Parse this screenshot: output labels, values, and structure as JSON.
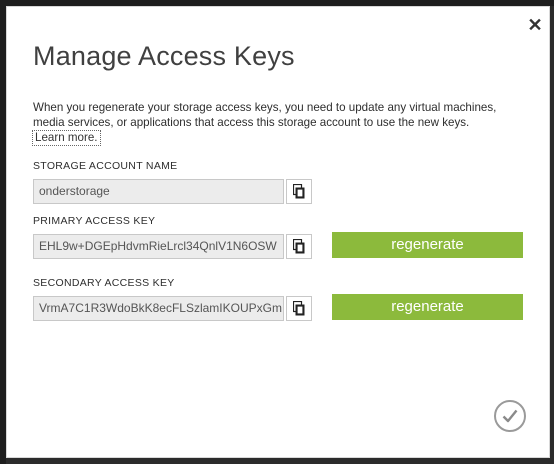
{
  "dialog": {
    "title": "Manage Access Keys",
    "description": "When you regenerate your storage access keys, you need to update any virtual machines, media services, or applications that access this storage account to use the new keys.",
    "learn_more": "Learn more",
    "learn_more_suffix": "."
  },
  "account": {
    "label": "STORAGE ACCOUNT NAME",
    "value": "onderstorage"
  },
  "primary": {
    "label": "PRIMARY ACCESS KEY",
    "value": "EHL9w+DGEpHdvmRieLrcl34QnlV1N6OSW",
    "regenerate_label": "regenerate"
  },
  "secondary": {
    "label": "SECONDARY ACCESS KEY",
    "value": "VrmA7C1R3WdoBkK8ecFLSzlamIKOUPxGm",
    "regenerate_label": "regenerate"
  },
  "icons": {
    "close": "close-icon",
    "copy": "copy-icon",
    "confirm": "checkmark-icon"
  },
  "colors": {
    "accent_green": "#8cba3c",
    "field_bg": "#ececec"
  }
}
